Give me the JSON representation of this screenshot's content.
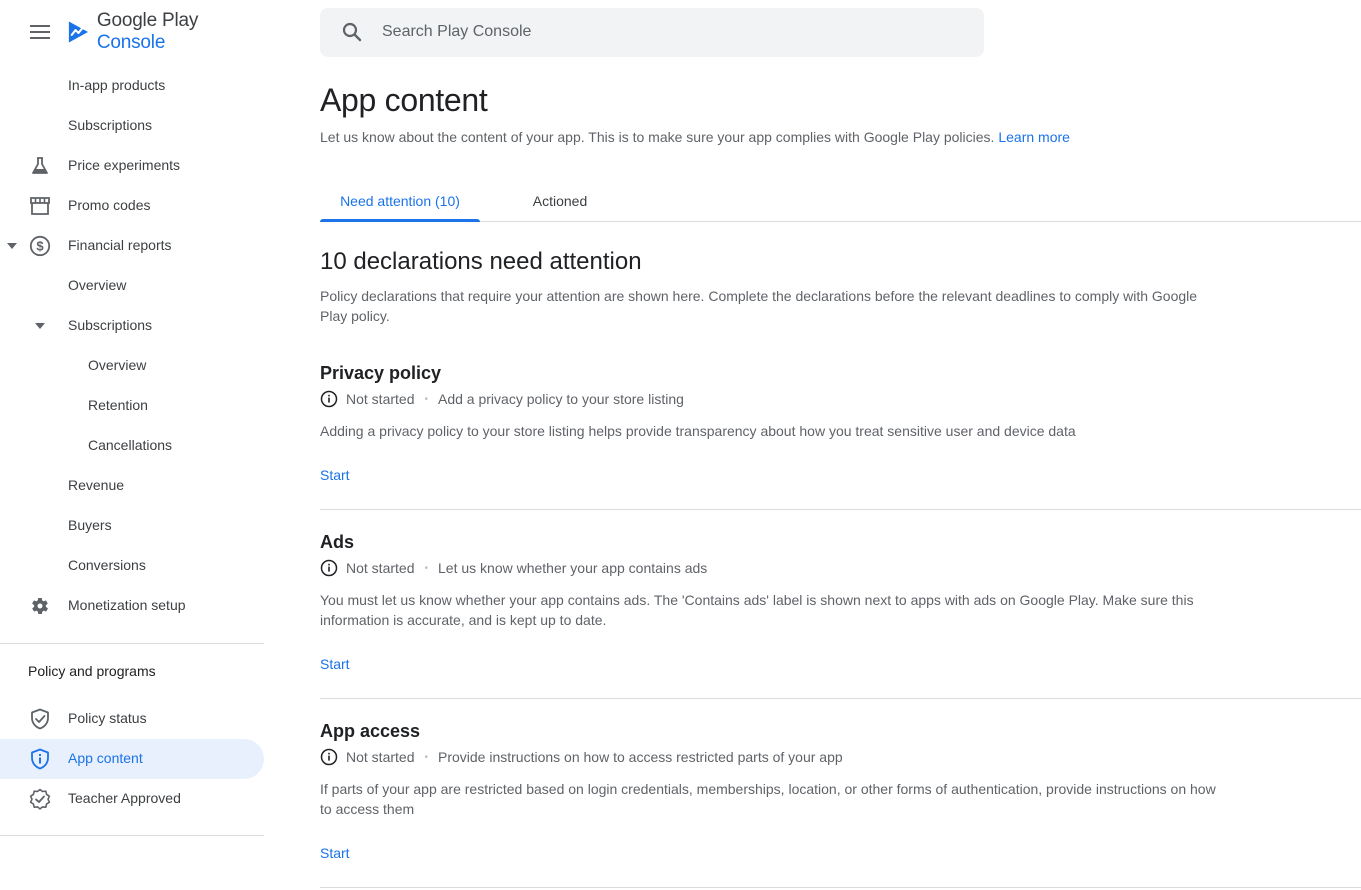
{
  "brand": {
    "google_play": "Google Play",
    "console": "Console"
  },
  "search": {
    "placeholder": "Search Play Console"
  },
  "sidebar": {
    "items": [
      {
        "label": "In-app products"
      },
      {
        "label": "Subscriptions"
      },
      {
        "label": "Price experiments",
        "icon": "flask-icon"
      },
      {
        "label": "Promo codes",
        "icon": "store-icon"
      },
      {
        "label": "Financial reports",
        "icon": "dollar-circle-icon"
      },
      {
        "label": "Overview"
      },
      {
        "label": "Subscriptions"
      },
      {
        "label": "Overview"
      },
      {
        "label": "Retention"
      },
      {
        "label": "Cancellations"
      },
      {
        "label": "Revenue"
      },
      {
        "label": "Buyers"
      },
      {
        "label": "Conversions"
      },
      {
        "label": "Monetization setup",
        "icon": "gear-icon"
      }
    ],
    "policy_header": "Policy and programs",
    "policy_items": [
      {
        "label": "Policy status",
        "icon": "shield-check-icon"
      },
      {
        "label": "App content",
        "icon": "shield-info-icon"
      },
      {
        "label": "Teacher Approved",
        "icon": "badge-icon"
      }
    ]
  },
  "main": {
    "title": "App content",
    "description": "Let us know about the content of your app. This is to make sure your app complies with Google Play policies.",
    "learn_more": "Learn more",
    "tabs": [
      {
        "label": "Need attention (10)"
      },
      {
        "label": "Actioned"
      }
    ],
    "section_title": "10 declarations need attention",
    "section_description": "Policy declarations that require your attention are shown here. Complete the declarations before the relevant deadlines to comply with Google Play policy.",
    "declarations": [
      {
        "title": "Privacy policy",
        "status": "Not started",
        "summary": "Add a privacy policy to your store listing",
        "body": "Adding a privacy policy to your store listing helps provide transparency about how you treat sensitive user and device data",
        "action": "Start"
      },
      {
        "title": "Ads",
        "status": "Not started",
        "summary": "Let us know whether your app contains ads",
        "body": "You must let us know whether your app contains ads. The 'Contains ads' label is shown next to apps with ads on Google Play. Make sure this information is accurate, and is kept up to date.",
        "action": "Start"
      },
      {
        "title": "App access",
        "status": "Not started",
        "summary": "Provide instructions on how to access restricted parts of your app",
        "body": "If parts of your app are restricted based on login credentials, memberships, location, or other forms of authentication, provide instructions on how to access them",
        "action": "Start"
      }
    ]
  },
  "colors": {
    "accent": "#1a73e8",
    "active_bg": "#e8f0fe",
    "divider": "#dadce0"
  }
}
